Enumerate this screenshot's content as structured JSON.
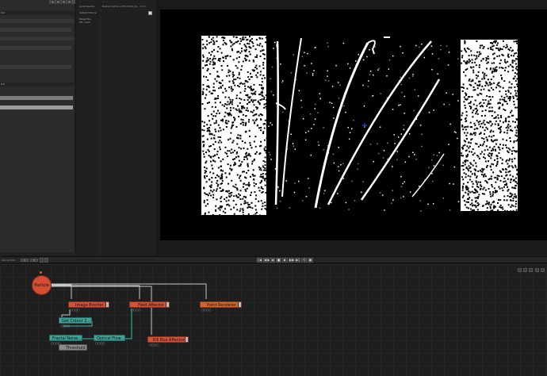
{
  "properties": {
    "field_label": "0.0",
    "field_value": "0.0"
  },
  "info": {
    "rows": [
      {
        "label": "...",
        "value": "...        ..."
      },
      {
        "label": "Local Device",
        "value": "NVIDIA GeForce RTX 3090 (0) - 1.5.0"
      },
      {
        "label": "Output Device",
        "value": ""
      },
      {
        "label": "Target fps",
        "value": ""
      },
      {
        "label": "Tot. vram",
        "value": ""
      }
    ]
  },
  "timeline": {
    "left_text": "mix 1n 000",
    "frame_start": "0",
    "frame_end": "0",
    "buttons": [
      "|◀",
      "◀◀",
      "◀",
      "■",
      "▶",
      "▶▶",
      "▶|",
      "⟲",
      "●"
    ]
  },
  "graph": {
    "particle_label": "Particle",
    "nodes": {
      "image_emitter": "Image Emitter",
      "field_affector": "Field Affector",
      "point_renderer": "Point Renderer",
      "get_colour": "Get Colour 2...",
      "fractal_noise": "Fractal Noise...",
      "optical_flow": "Optical Flow...",
      "threshold": "Threshold",
      "kill_box": "Kill Box Affector"
    },
    "port_dots": "○○○○"
  },
  "colors": {
    "node_red": "#d2513a",
    "node_orange": "#d0652e",
    "node_teal": "#3fa198",
    "node_gray": "#8a8a8a",
    "wire": "#c8c8c8",
    "wire_teal": "#3fb7b0"
  }
}
